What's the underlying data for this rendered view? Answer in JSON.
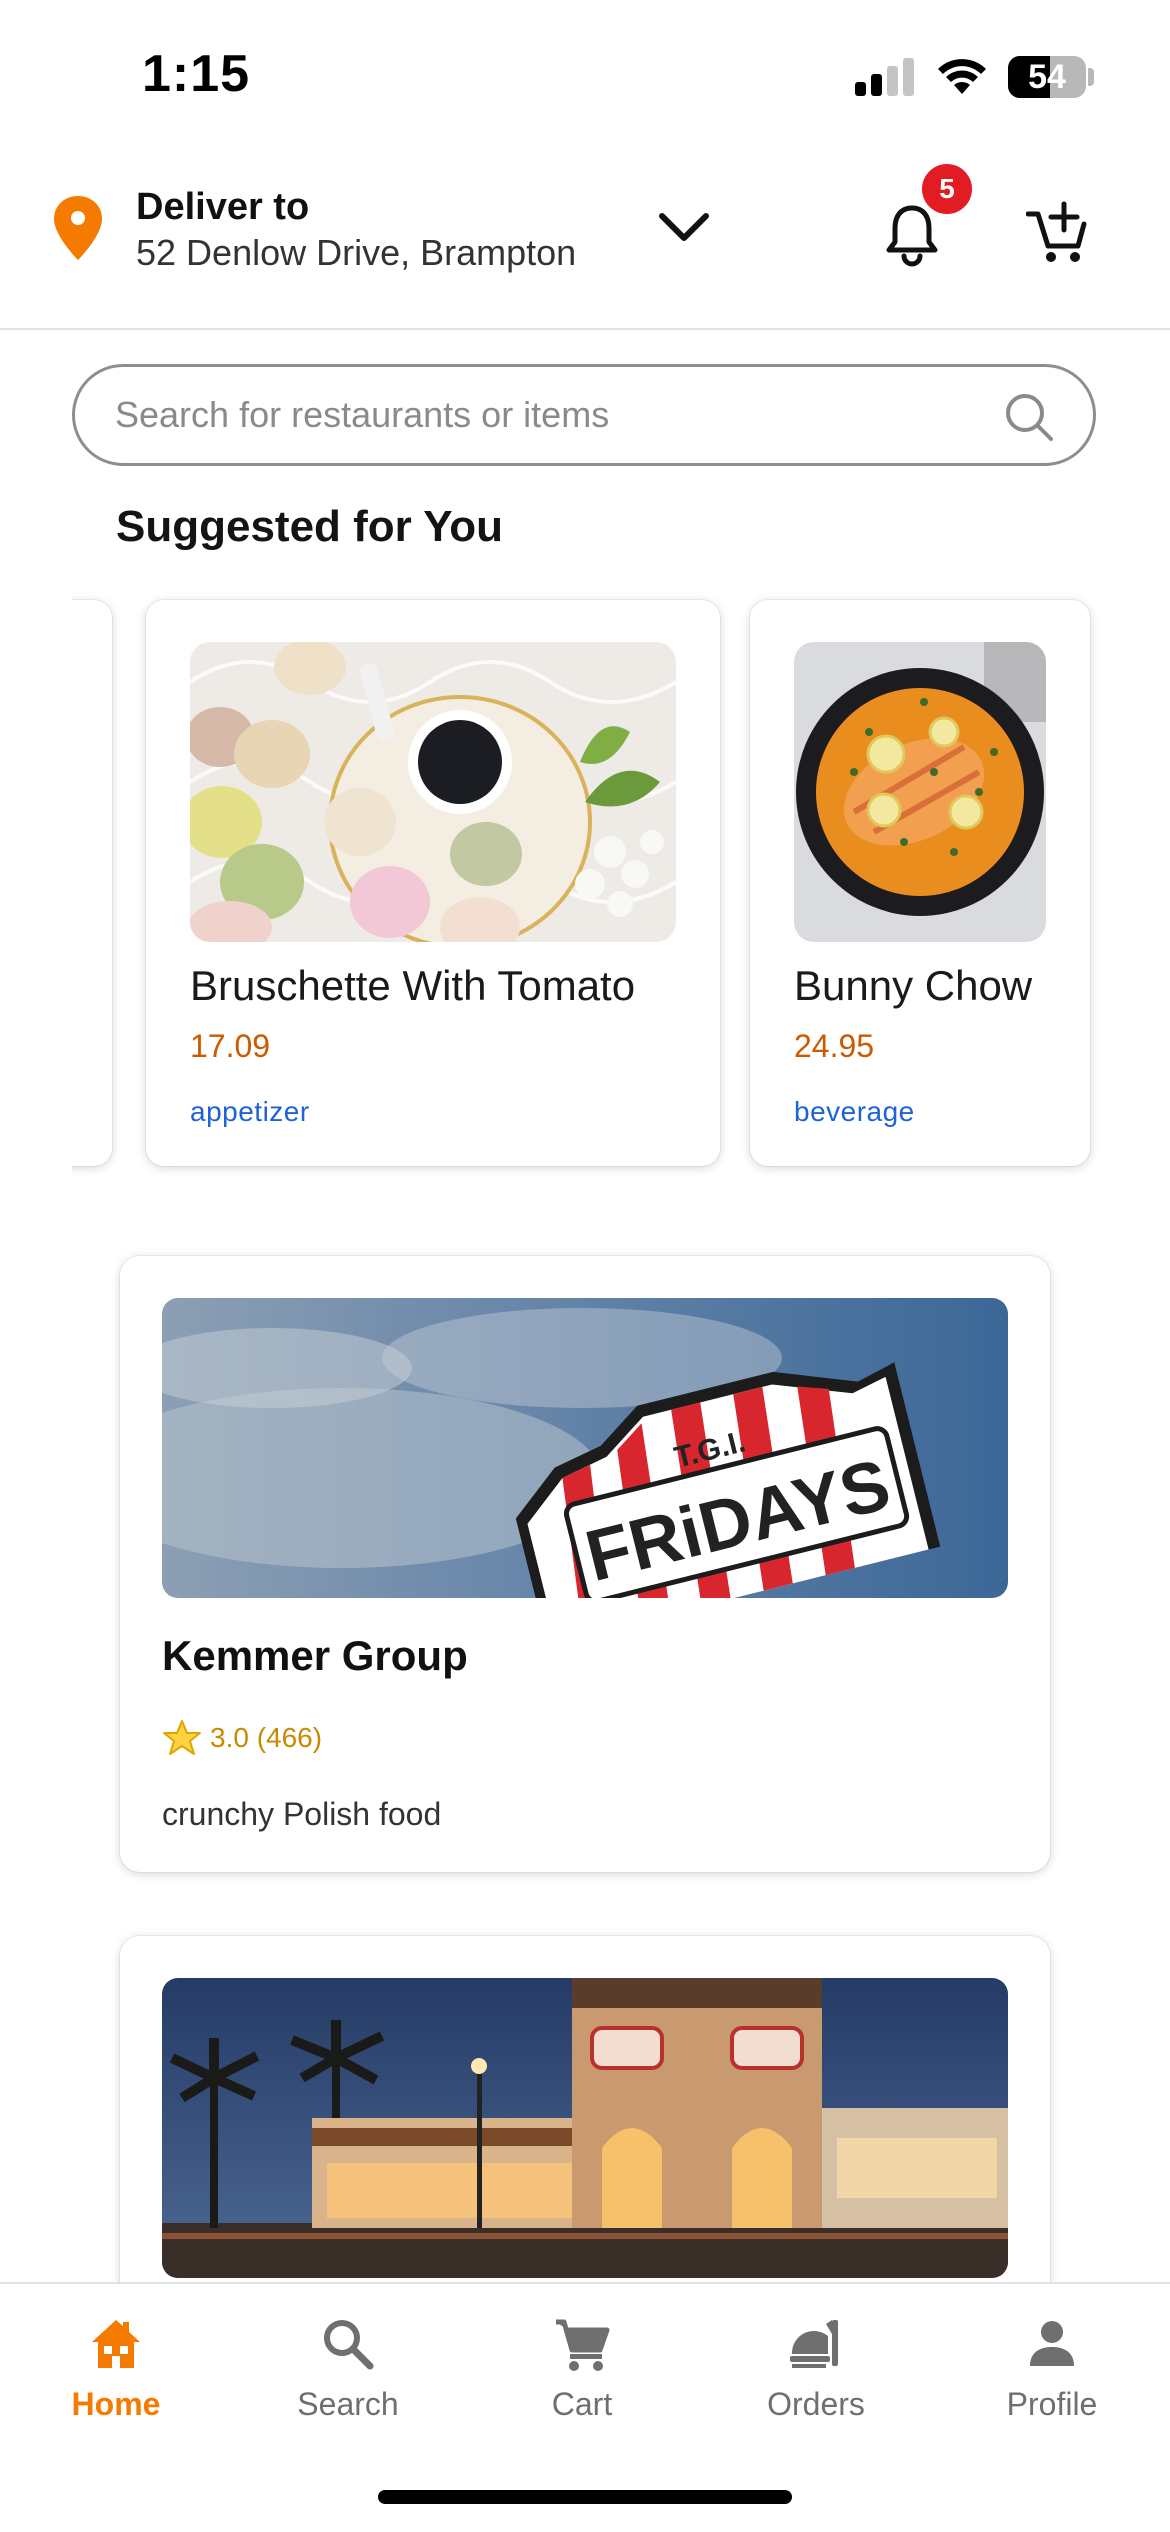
{
  "status_bar": {
    "time": "1:15",
    "battery": "54",
    "battery_level": 0.54
  },
  "header": {
    "deliver_label": "Deliver to",
    "address": "52 Denlow Drive, Brampton",
    "notification_count": "5"
  },
  "search": {
    "placeholder": "Search for restaurants or items",
    "value": ""
  },
  "suggested": {
    "title": "Suggested for You",
    "items": [
      {
        "name": "Bruschette With Tomato",
        "price": "17.09",
        "category": "appetizer",
        "image": "macarons-coffee-photo"
      },
      {
        "name": "Bunny Chow",
        "price": "24.95",
        "category": "beverage",
        "image": "salmon-curry-pan-photo"
      }
    ]
  },
  "restaurants": [
    {
      "name": "Kemmer Group",
      "rating": "3.0 (466)",
      "description": "crunchy Polish food",
      "image": "tgi-fridays-sign-photo"
    },
    {
      "image": "restaurant-storefront-night-photo"
    }
  ],
  "bottom_nav": {
    "items": [
      {
        "label": "Home",
        "icon": "home-icon",
        "active": true
      },
      {
        "label": "Search",
        "icon": "search-icon",
        "active": false
      },
      {
        "label": "Cart",
        "icon": "cart-icon",
        "active": false
      },
      {
        "label": "Orders",
        "icon": "orders-icon",
        "active": false
      },
      {
        "label": "Profile",
        "icon": "person-icon",
        "active": false
      }
    ]
  },
  "colors": {
    "accent": "#f47b00",
    "price": "#cc5a00",
    "category": "#1e63d6",
    "rating": "#c98a00",
    "badge": "#e31b23"
  }
}
